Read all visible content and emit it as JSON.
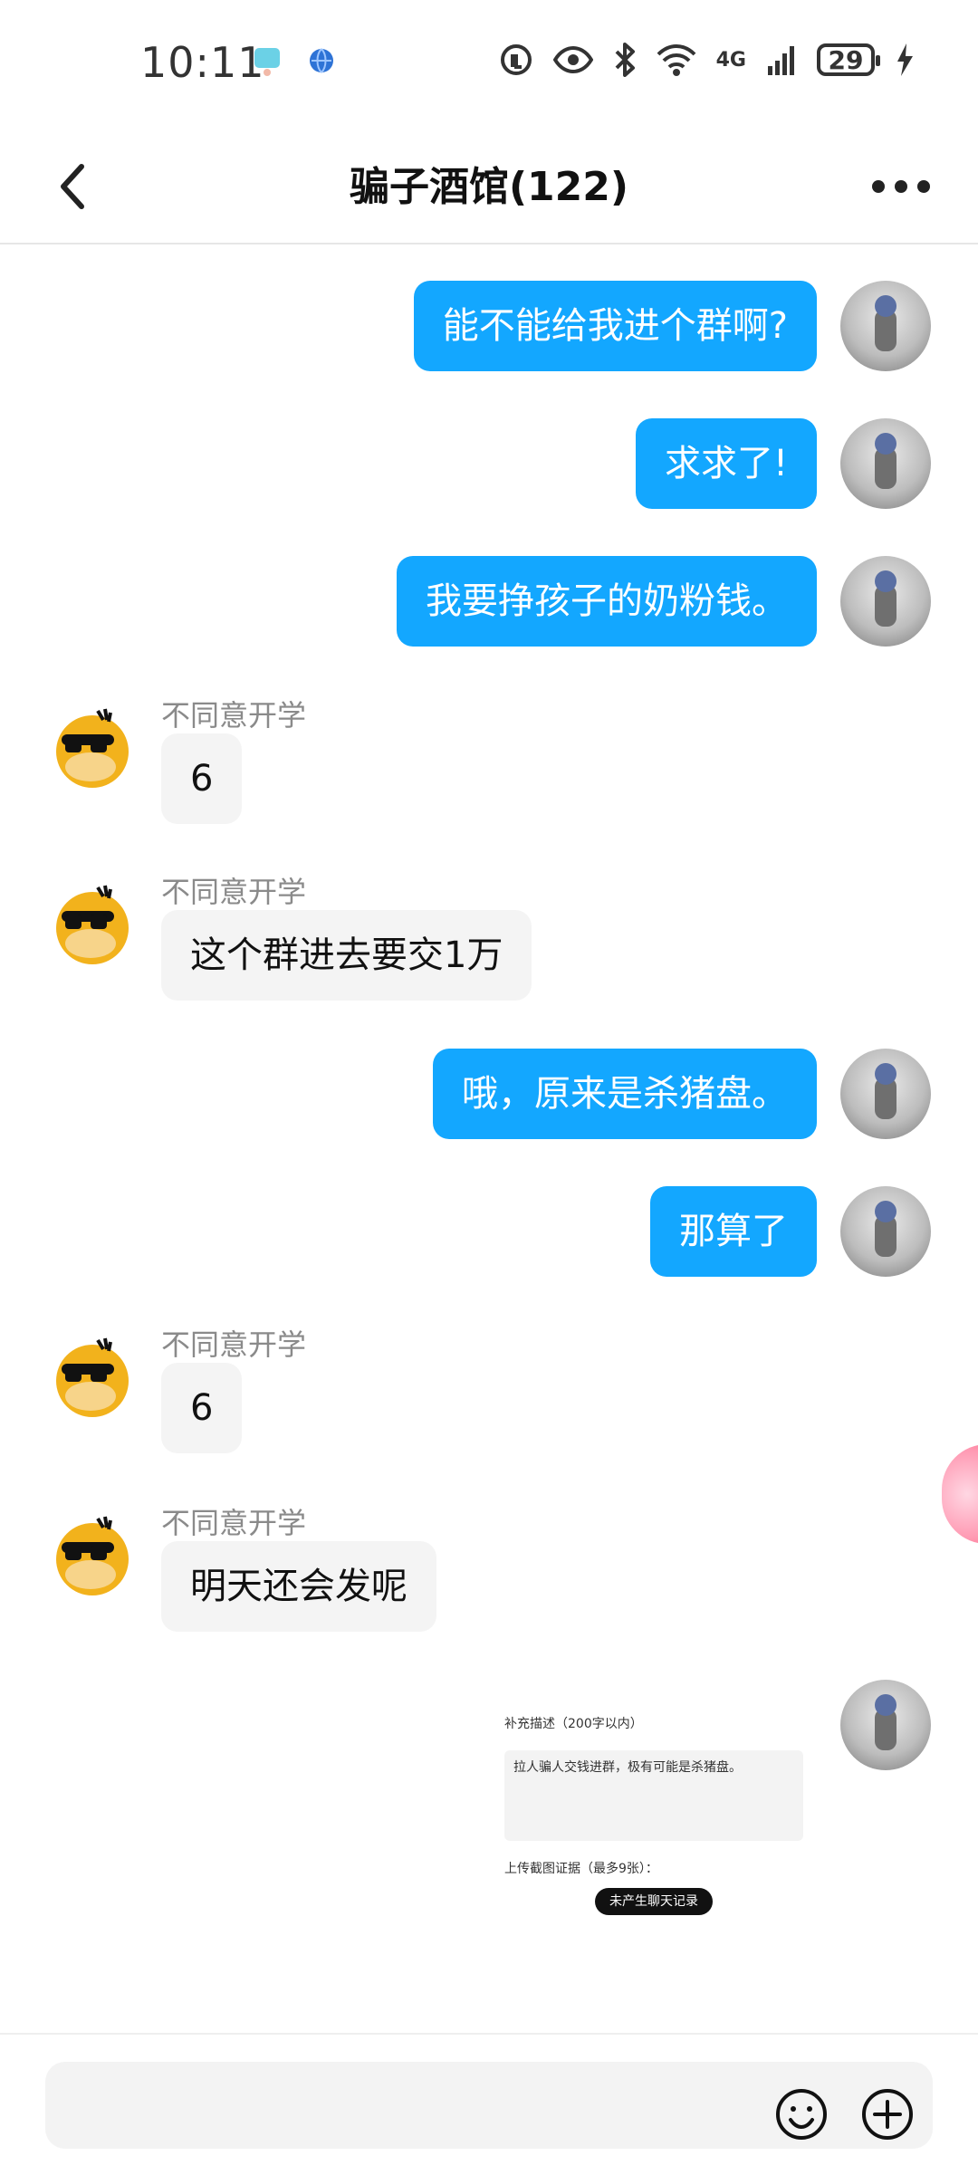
{
  "status_bar": {
    "time": "10:11",
    "battery": "29",
    "network": "4G"
  },
  "header": {
    "title": "骗子酒馆(122)"
  },
  "messages": [
    {
      "from": "me",
      "text": "能不能给我进个群啊?"
    },
    {
      "from": "me",
      "text": "求求了!"
    },
    {
      "from": "me",
      "text": "我要挣孩子的奶粉钱。"
    },
    {
      "from": "other",
      "sender": "不同意开学",
      "text": "6"
    },
    {
      "from": "other",
      "sender": "不同意开学",
      "text": "这个群进去要交1万"
    },
    {
      "from": "me",
      "text": "哦，原来是杀猪盘。"
    },
    {
      "from": "me",
      "text": "那算了"
    },
    {
      "from": "other",
      "sender": "不同意开学",
      "text": "6"
    },
    {
      "from": "other",
      "sender": "不同意开学",
      "text": "明天还会发呢"
    }
  ],
  "image_message": {
    "line1": "补充描述（200字以内）",
    "line2": "拉人骗人交钱进群，极有可能是杀猪盘。",
    "line3": "上传截图证据（最多9张）：",
    "pill": "未产生聊天记录"
  },
  "icons": {
    "back": "back-icon",
    "more": "more-icon",
    "emoji": "emoji-icon",
    "plus": "plus-icon"
  },
  "colors": {
    "accent": "#13a7ff",
    "other_bubble": "#f4f4f4"
  }
}
